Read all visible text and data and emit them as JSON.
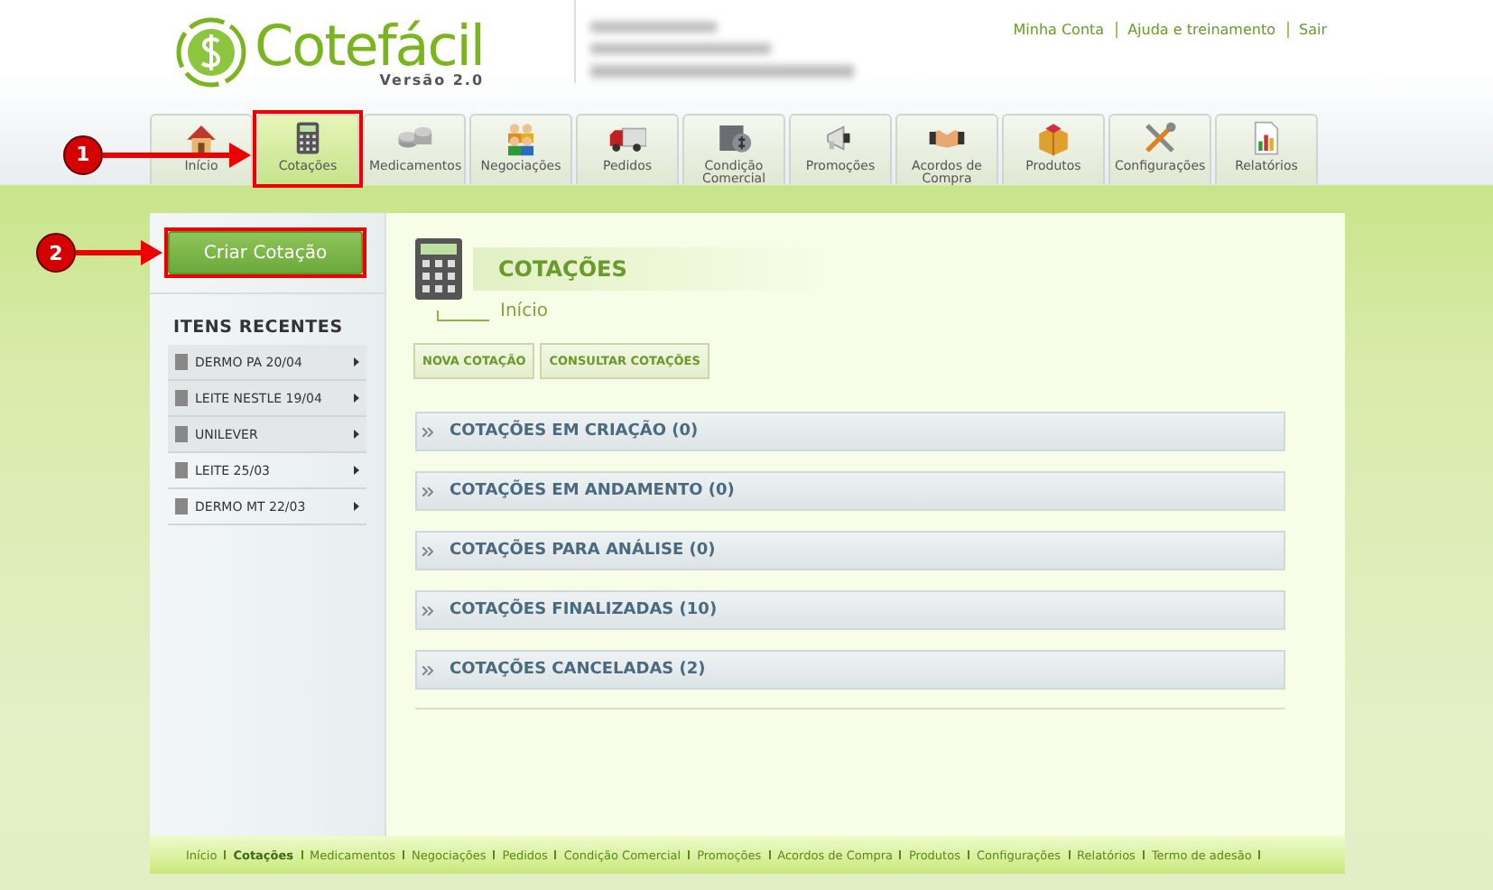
{
  "logo": {
    "name": "Cotefácil",
    "version": "Versão 2.0"
  },
  "top_links": [
    "Minha Conta",
    "Ajuda e treinamento",
    "Sair"
  ],
  "nav_tabs": [
    {
      "label": "Início",
      "kind": "home",
      "selected": false
    },
    {
      "label": "Cotações",
      "kind": "calculator",
      "selected": true,
      "step": "1"
    },
    {
      "label": "Medicamentos",
      "kind": "coins",
      "selected": false
    },
    {
      "label": "Negociações",
      "kind": "people",
      "selected": false
    },
    {
      "label": "Pedidos",
      "kind": "truck",
      "selected": false
    },
    {
      "label": "Condição Comercial",
      "kind": "safe",
      "selected": false
    },
    {
      "label": "Promoções",
      "kind": "megaphone",
      "selected": false
    },
    {
      "label": "Acordos de Compra",
      "kind": "handshake",
      "selected": false
    },
    {
      "label": "Produtos",
      "kind": "box",
      "selected": false
    },
    {
      "label": "Configurações",
      "kind": "tools",
      "selected": false
    },
    {
      "label": "Relatórios",
      "kind": "chart",
      "selected": false
    }
  ],
  "create_button": {
    "label": "Criar Cotação",
    "step": "2"
  },
  "recent": {
    "title": "ITENS RECENTES",
    "items": [
      {
        "label": "DERMO PA 20/04",
        "highlighted": true
      },
      {
        "label": "LEITE NESTLE 19/04",
        "highlighted": true
      },
      {
        "label": "UNILEVER",
        "highlighted": true
      },
      {
        "label": "LEITE 25/03",
        "highlighted": false
      },
      {
        "label": "DERMO MT 22/03",
        "highlighted": false
      }
    ]
  },
  "page": {
    "title": "COTAÇÕES",
    "breadcrumb": "Início"
  },
  "actions": [
    "NOVA COTAÇÃO",
    "CONSULTAR COTAÇÕES"
  ],
  "sections": [
    {
      "label": "COTAÇÕES EM CRIAÇÃO (0)",
      "expanded": false
    },
    {
      "label": "COTAÇÕES EM ANDAMENTO (0)",
      "expanded": false
    },
    {
      "label": "COTAÇÕES PARA ANÁLISE (0)",
      "expanded": false
    },
    {
      "label": "COTAÇÕES FINALIZADAS (10)",
      "expanded": false
    },
    {
      "label": "COTAÇÕES CANCELADAS (2)",
      "expanded": false
    }
  ],
  "footer_links": [
    {
      "label": "Início",
      "selected": false
    },
    {
      "label": "Cotações",
      "selected": true
    },
    {
      "label": "Medicamentos",
      "selected": false
    },
    {
      "label": "Negociações",
      "selected": false
    },
    {
      "label": "Pedidos",
      "selected": false
    },
    {
      "label": "Condição Comercial",
      "selected": false
    },
    {
      "label": "Promoções",
      "selected": false
    },
    {
      "label": "Acordos de Compra",
      "selected": false
    },
    {
      "label": "Produtos",
      "selected": false
    },
    {
      "label": "Configurações",
      "selected": false
    },
    {
      "label": "Relatórios",
      "selected": false
    },
    {
      "label": "Termo de adesão",
      "selected": false
    }
  ]
}
